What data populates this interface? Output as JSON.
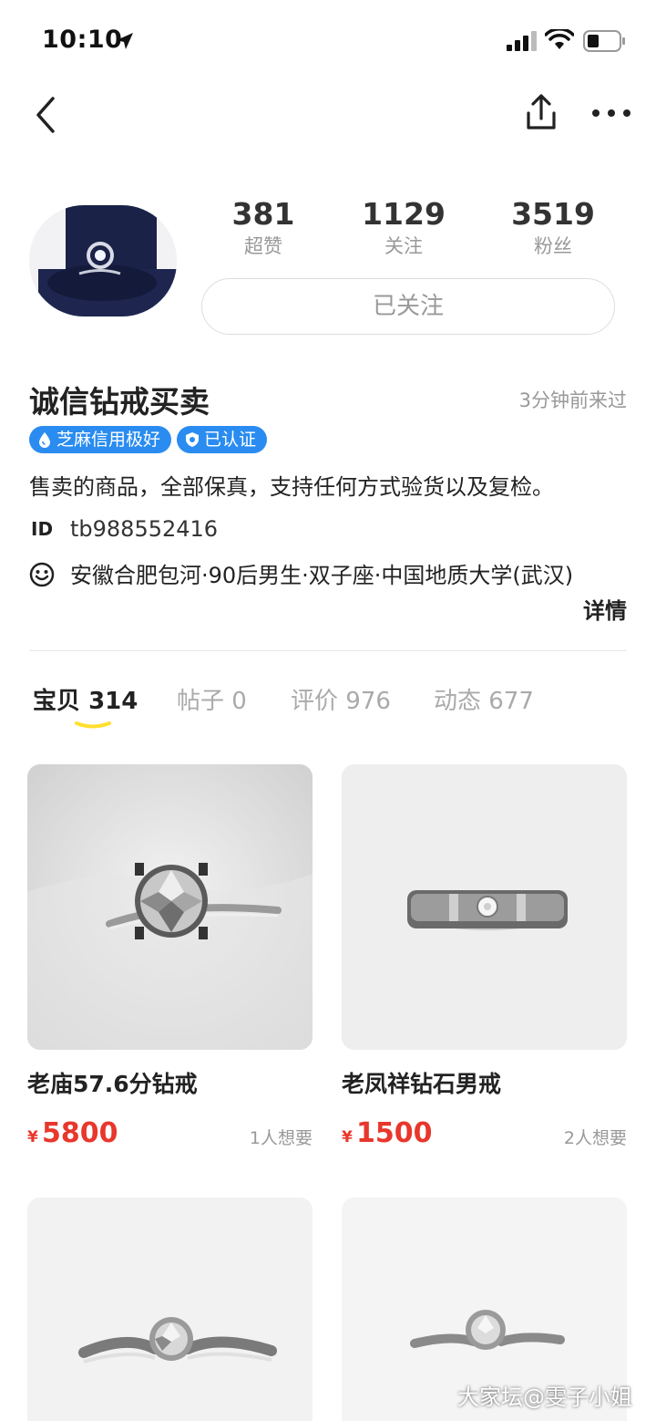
{
  "status_bar": {
    "time": "10:10"
  },
  "profile": {
    "stats": [
      {
        "num": "381",
        "label": "超赞"
      },
      {
        "num": "1129",
        "label": "关注"
      },
      {
        "num": "3519",
        "label": "粉丝"
      }
    ],
    "follow_label": "已关注",
    "name": "诚信钻戒买卖",
    "last_seen": "3分钟前来过",
    "badges": [
      {
        "label": "芝麻信用极好",
        "icon": "drop-icon"
      },
      {
        "label": "已认证",
        "icon": "verified-shield-icon"
      }
    ],
    "bio": "售卖的商品，全部保真，支持任何方式验货以及复检。",
    "id_label": "ID",
    "id_value": "tb988552416",
    "info": "安徽合肥包河·90后男生·双子座·中国地质大学(武汉)",
    "detail_link": "详情"
  },
  "tabs": [
    {
      "label": "宝贝",
      "count": "314"
    },
    {
      "label": "帖子",
      "count": "0"
    },
    {
      "label": "评价",
      "count": "976"
    },
    {
      "label": "动态",
      "count": "677"
    }
  ],
  "items": [
    {
      "title": "老庙57.6分钻戒",
      "currency": "¥",
      "price": "5800",
      "wants": "1人想要"
    },
    {
      "title": "老凤祥钻石男戒",
      "currency": "¥",
      "price": "1500",
      "wants": "2人想要"
    }
  ],
  "watermark": "大家坛@雯子小姐",
  "colors": {
    "accent_blue": "#2a8cf0",
    "price_red": "#e8372c",
    "tab_indicator": "#ffdf2e"
  }
}
